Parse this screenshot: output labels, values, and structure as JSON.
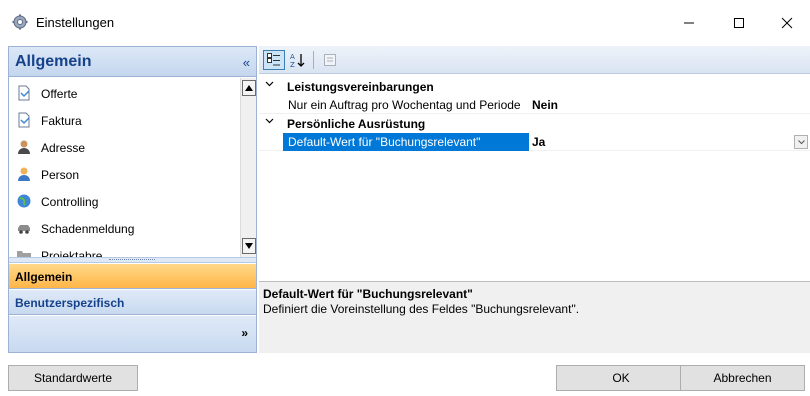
{
  "window": {
    "title": "Einstellungen",
    "controls": {
      "minimize": "—",
      "maximize": "☐",
      "close": "✕"
    }
  },
  "navigation": {
    "header": "Allgemein",
    "collapse_glyph": "«",
    "items": [
      {
        "label": "Offerte",
        "icon": "document-icon"
      },
      {
        "label": "Faktura",
        "icon": "document-icon"
      },
      {
        "label": "Adresse",
        "icon": "user-icon"
      },
      {
        "label": "Person",
        "icon": "user-icon"
      },
      {
        "label": "Controlling",
        "icon": "globe-icon"
      },
      {
        "label": "Schadenmeldung",
        "icon": "car-icon"
      },
      {
        "label": "Projektabre...",
        "icon": "folder-icon"
      }
    ],
    "groups": [
      {
        "label": "Allgemein",
        "active": true
      },
      {
        "label": "Benutzerspezifisch",
        "active": false
      }
    ],
    "overflow_glyph": "»"
  },
  "property_grid": {
    "categories": [
      {
        "label": "Leistungsvereinbarungen",
        "properties": [
          {
            "name": "Nur ein Auftrag pro Wochentag und Periode",
            "value": "Nein",
            "selected": false
          }
        ]
      },
      {
        "label": "Persönliche Ausrüstung",
        "properties": [
          {
            "name": "Default-Wert für \"Buchungsrelevant\"",
            "value": "Ja",
            "selected": true
          }
        ]
      }
    ],
    "description": {
      "title": "Default-Wert für \"Buchungsrelevant\"",
      "text": "Definiert die Voreinstellung des Feldes \"Buchungsrelevant\"."
    }
  },
  "buttons": {
    "defaults": "Standardwerte",
    "ok": "OK",
    "cancel": "Abbrechen"
  },
  "colors": {
    "accent_selected": "#0078d7",
    "nav_active": "#ffb547",
    "nav_header_text": "#15428b"
  }
}
